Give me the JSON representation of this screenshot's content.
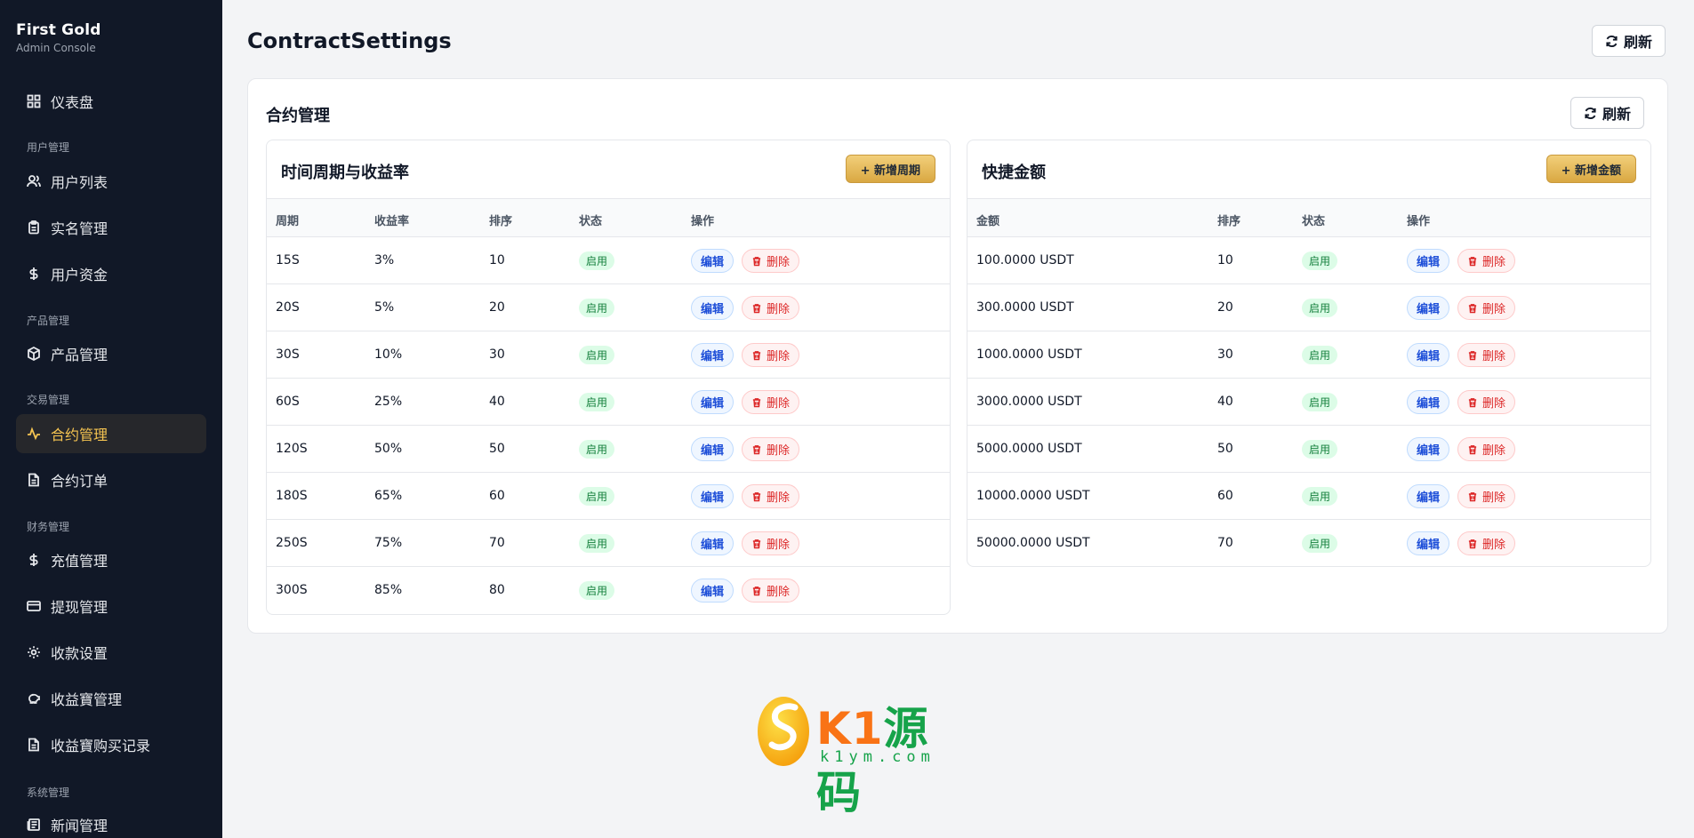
{
  "brand": {
    "title": "First Gold",
    "subtitle": "Admin Console"
  },
  "nav": {
    "dashboard": "仪表盘",
    "section_user": "用户管理",
    "users": "用户列表",
    "realname": "实名管理",
    "funds": "用户资金",
    "section_product": "产品管理",
    "products": "产品管理",
    "section_trade": "交易管理",
    "contracts": "合约管理",
    "contract_orders": "合约订单",
    "section_finance": "财务管理",
    "recharge": "充值管理",
    "withdraw": "提现管理",
    "payment": "收款设置",
    "yield": "收益寶管理",
    "yield_records": "收益寶购买记录",
    "section_system": "系统管理",
    "news": "新闻管理"
  },
  "page": {
    "title": "ContractSettings",
    "refresh": "刷新"
  },
  "card": {
    "title": "合约管理",
    "refresh": "刷新"
  },
  "periods": {
    "title": "时间周期与收益率",
    "add_label": "+ 新增周期",
    "headers": [
      "周期",
      "收益率",
      "排序",
      "状态",
      "操作"
    ],
    "rows": [
      {
        "period": "15S",
        "rate": "3%",
        "sort": "10",
        "status": "启用"
      },
      {
        "period": "20S",
        "rate": "5%",
        "sort": "20",
        "status": "启用"
      },
      {
        "period": "30S",
        "rate": "10%",
        "sort": "30",
        "status": "启用"
      },
      {
        "period": "60S",
        "rate": "25%",
        "sort": "40",
        "status": "启用"
      },
      {
        "period": "120S",
        "rate": "50%",
        "sort": "50",
        "status": "启用"
      },
      {
        "period": "180S",
        "rate": "65%",
        "sort": "60",
        "status": "启用"
      },
      {
        "period": "250S",
        "rate": "75%",
        "sort": "70",
        "status": "启用"
      },
      {
        "period": "300S",
        "rate": "85%",
        "sort": "80",
        "status": "启用"
      }
    ]
  },
  "amounts": {
    "title": "快捷金额",
    "add_label": "+ 新增金额",
    "headers": [
      "金额",
      "排序",
      "状态",
      "操作"
    ],
    "rows": [
      {
        "amount": "100.0000 USDT",
        "sort": "10",
        "status": "启用"
      },
      {
        "amount": "300.0000 USDT",
        "sort": "20",
        "status": "启用"
      },
      {
        "amount": "1000.0000 USDT",
        "sort": "30",
        "status": "启用"
      },
      {
        "amount": "3000.0000 USDT",
        "sort": "40",
        "status": "启用"
      },
      {
        "amount": "5000.0000 USDT",
        "sort": "50",
        "status": "启用"
      },
      {
        "amount": "10000.0000 USDT",
        "sort": "60",
        "status": "启用"
      },
      {
        "amount": "50000.0000 USDT",
        "sort": "70",
        "status": "启用"
      }
    ]
  },
  "actions": {
    "edit": "编辑",
    "delete": "删除"
  },
  "watermark": {
    "brand_prefix": "K1",
    "brand_cn": "源码",
    "url": "k1ym.com"
  },
  "colors": {
    "sidebar_bg": "#111827",
    "accent_gold": "#f5c451",
    "status_green": "#15803d",
    "edit_blue": "#1d4ed8",
    "delete_red": "#dc2626"
  }
}
